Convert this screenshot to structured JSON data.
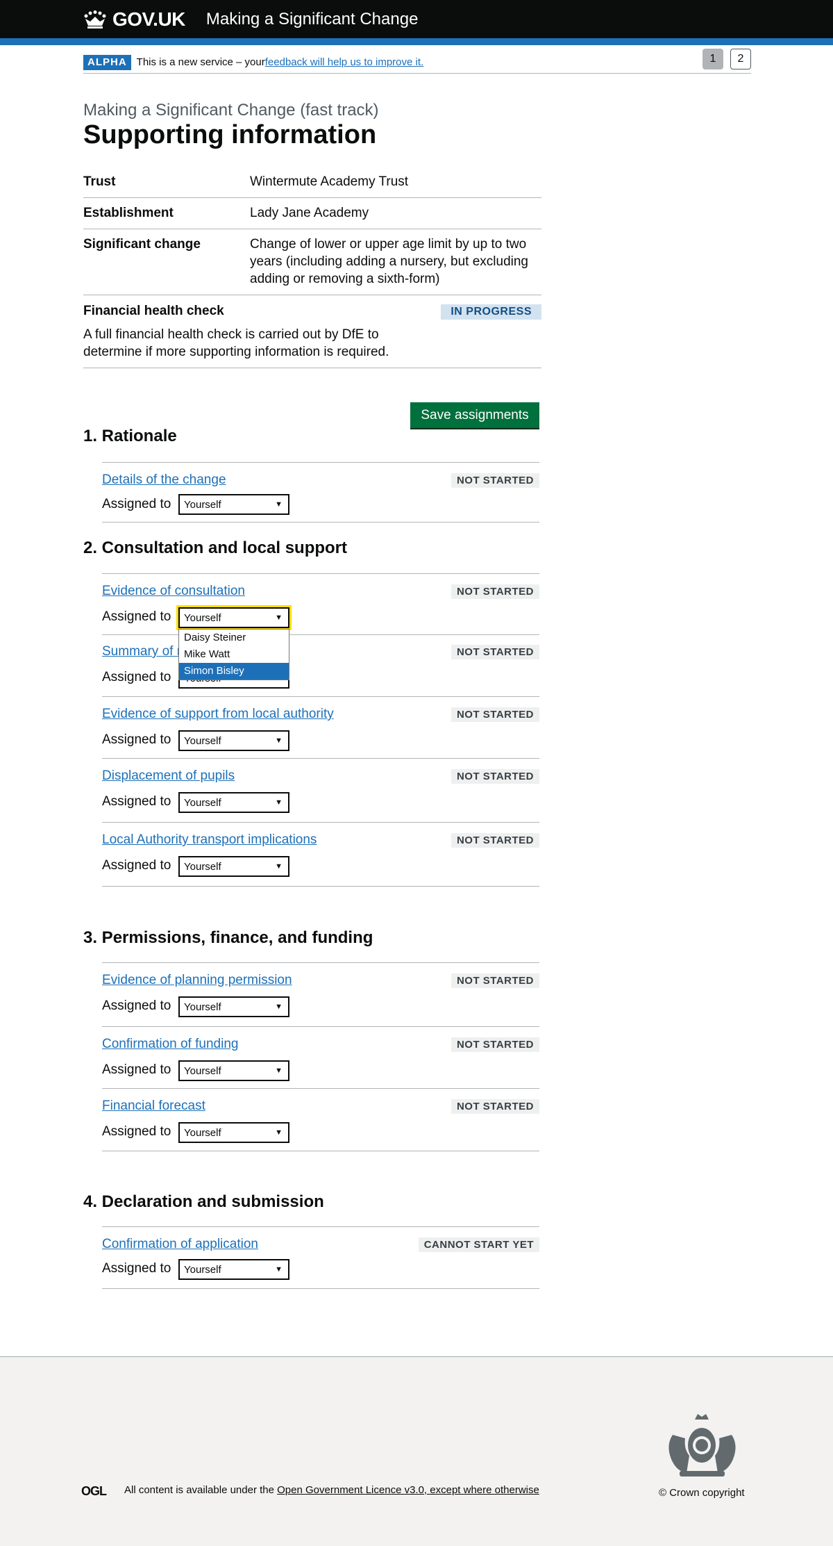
{
  "header": {
    "logo_text": "GOV.UK",
    "service_name": "Making a Significant Change"
  },
  "phase_banner": {
    "tag": "ALPHA",
    "text": "This is a new service – your ",
    "link": "feedback will help us to improve it.",
    "pages": [
      "1",
      "2"
    ],
    "active_page": "1"
  },
  "page": {
    "caption": "Making a Significant Change (fast track)",
    "title": "Supporting information"
  },
  "summary": [
    {
      "key": "Trust",
      "value": "Wintermute Academy Trust"
    },
    {
      "key": "Establishment",
      "value": "Lady Jane Academy"
    },
    {
      "key": "Significant change",
      "value": "Change of lower or upper age limit by up to two years (including adding a nursery, but excluding adding or removing a sixth-form)"
    }
  ],
  "health_check": {
    "title": "Financial health check",
    "status": "IN PROGRESS",
    "text": "A full financial health check is carried out by DfE to determine if more supporting information is required."
  },
  "save_button": "Save assignments",
  "assigned_label": "Assigned to",
  "sections": [
    {
      "heading": "1. Rationale",
      "tasks": [
        {
          "link": "Details of the change",
          "status": "NOT STARTED",
          "assignee": "Yourself"
        }
      ]
    },
    {
      "heading": "2. Consultation and local support",
      "tasks": [
        {
          "link": "Evidence of consultation",
          "status": "NOT STARTED",
          "assignee": "Yourself"
        },
        {
          "link": "Summary of r",
          "status": "NOT STARTED",
          "assignee": "Yourself"
        },
        {
          "link": "Evidence of support from local authority",
          "status": "NOT STARTED",
          "assignee": "Yourself"
        },
        {
          "link": "Displacement of pupils",
          "status": "NOT STARTED",
          "assignee": "Yourself"
        },
        {
          "link": "Local Authority transport implications",
          "status": "NOT STARTED",
          "assignee": "Yourself"
        }
      ]
    },
    {
      "heading": "3. Permissions, finance, and funding",
      "tasks": [
        {
          "link": "Evidence of planning permission",
          "status": "NOT STARTED",
          "assignee": "Yourself"
        },
        {
          "link": "Confirmation of funding",
          "status": "NOT STARTED",
          "assignee": "Yourself"
        },
        {
          "link": "Financial forecast",
          "status": "NOT STARTED",
          "assignee": "Yourself"
        }
      ]
    },
    {
      "heading": "4. Declaration and submission",
      "tasks": [
        {
          "link": "Confirmation of application",
          "status": "CANNOT START YET",
          "assignee": "Yourself"
        }
      ]
    }
  ],
  "dropdown_options": [
    "Daisy Steiner",
    "Mike Watt",
    "Simon Bisley"
  ],
  "dropdown_highlighted": "Simon Bisley",
  "footer": {
    "licence_prefix": "All content is available under the ",
    "licence_link": "Open Government Licence v3.0, except where otherwise",
    "ogl": "OGL",
    "copyright": "© Crown copyright"
  },
  "colors": {
    "header_bg": "#0b0c0c",
    "brand_blue": "#1d70b8",
    "button_green": "#00703c",
    "focus_yellow": "#ffdd00"
  }
}
